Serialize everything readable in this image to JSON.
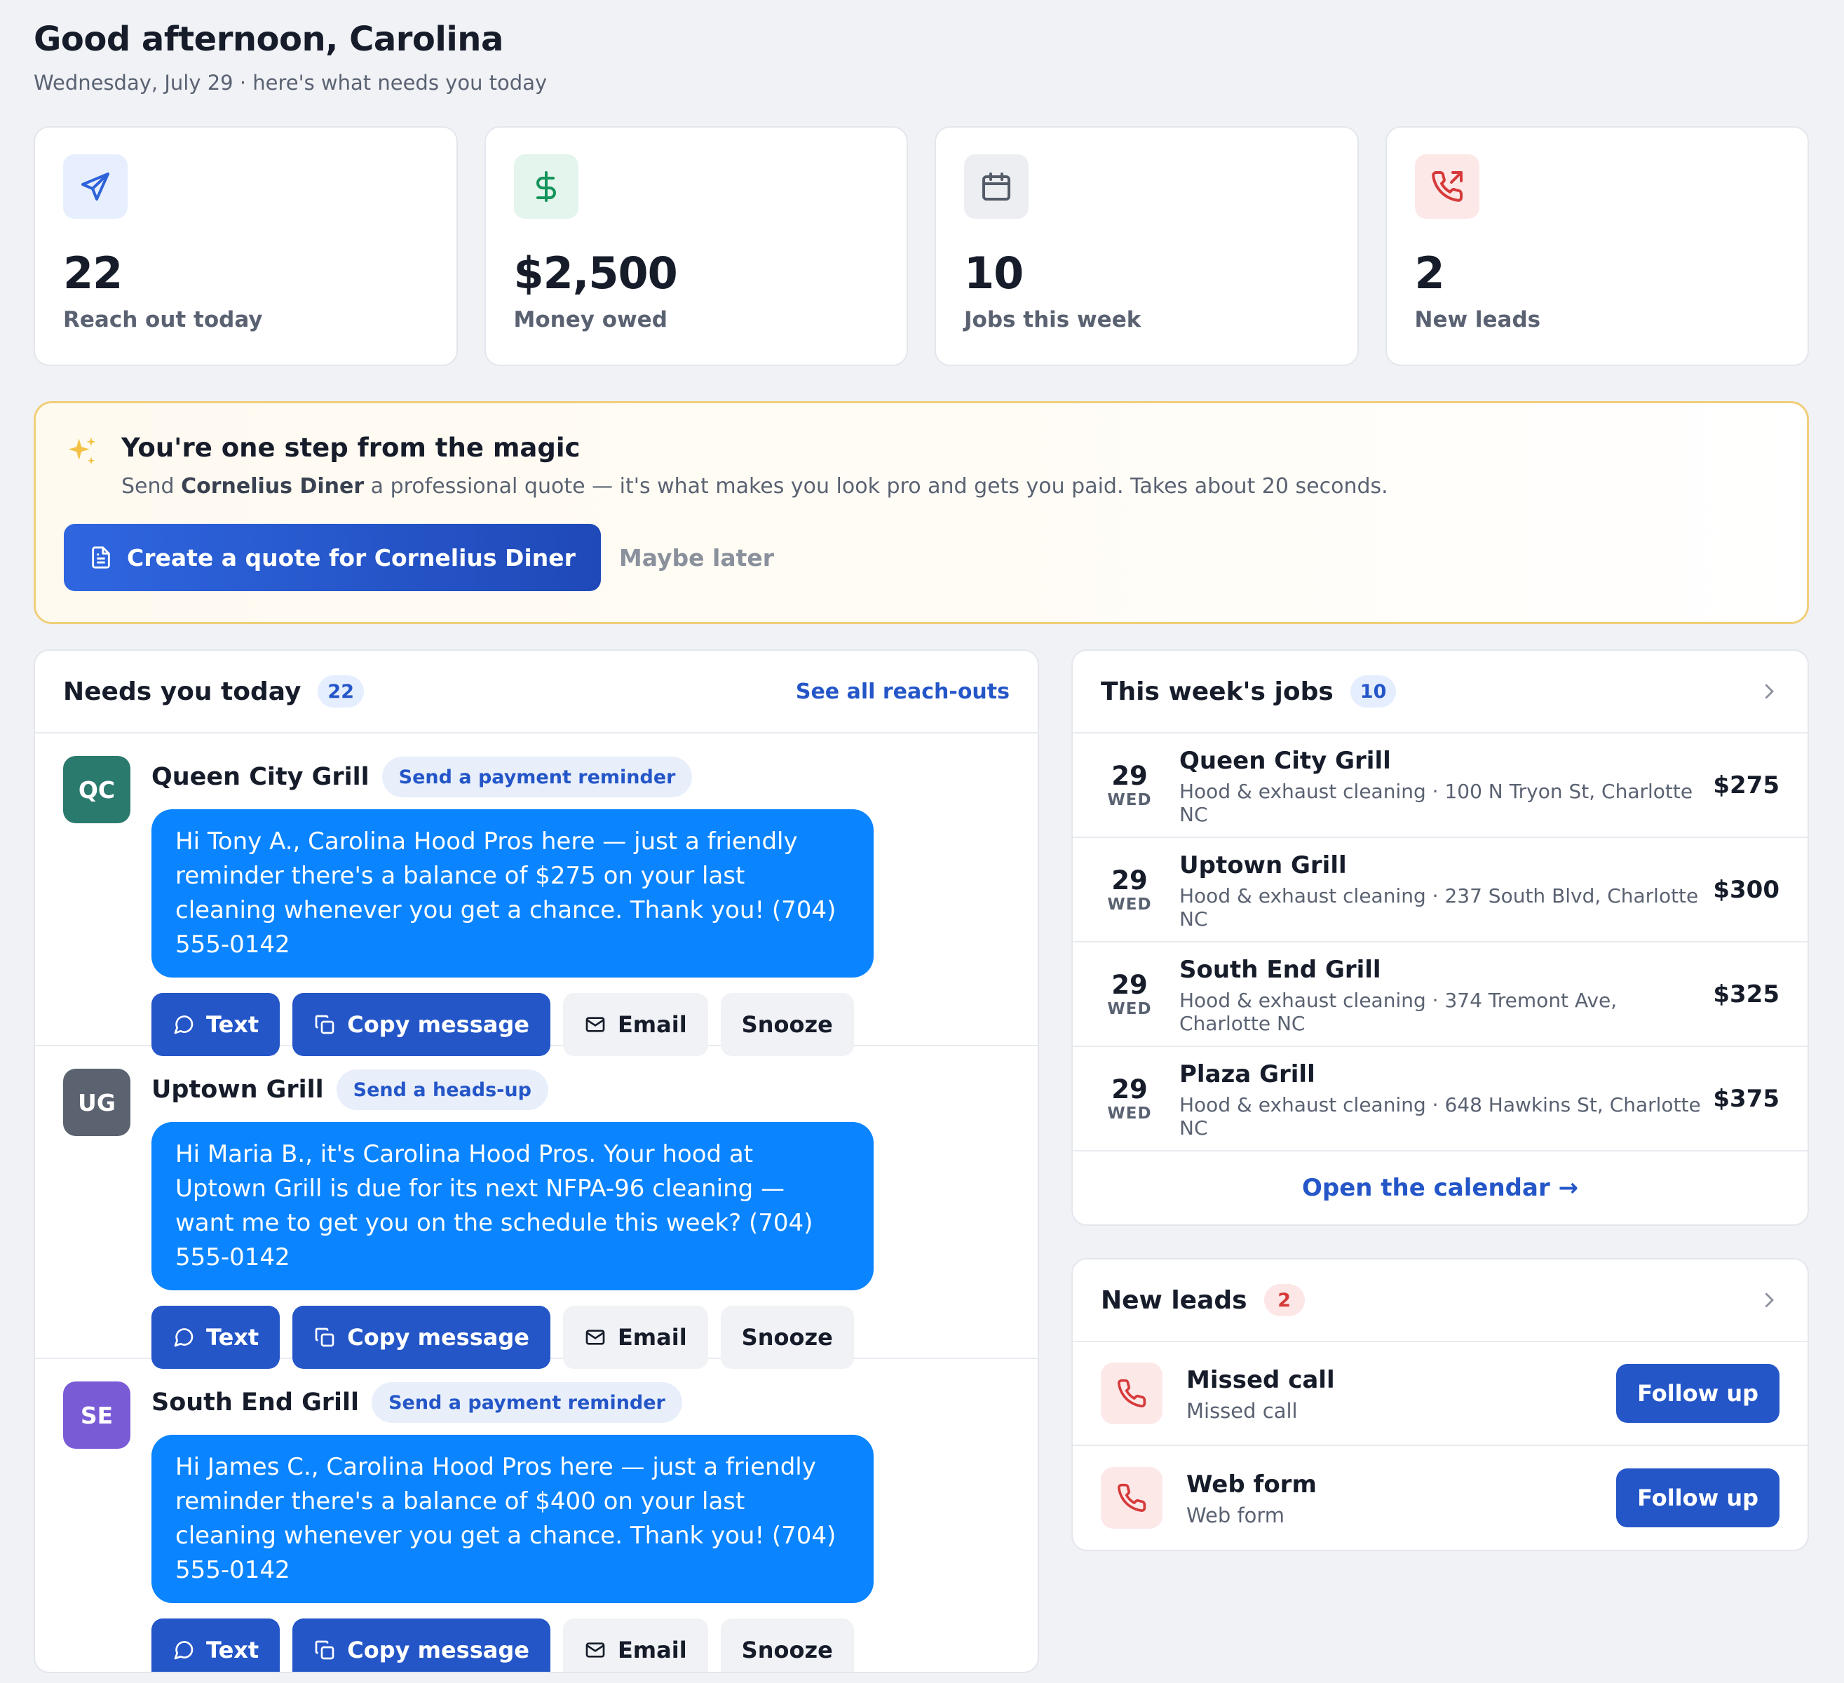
{
  "header": {
    "greeting": "Good afternoon, Carolina",
    "date_line": "Wednesday, July 29 · here's what needs you today"
  },
  "stats": [
    {
      "icon": "send-icon",
      "value": "22",
      "label": "Reach out today",
      "bg": "#e7efff",
      "fg": "#2e62d9"
    },
    {
      "icon": "dollar-icon",
      "value": "$2,500",
      "label": "Money owed",
      "bg": "#e3f5ec",
      "fg": "#14945a"
    },
    {
      "icon": "calendar-icon",
      "value": "10",
      "label": "Jobs this week",
      "bg": "#eceef2",
      "fg": "#545b68"
    },
    {
      "icon": "phone-outgoing-icon",
      "value": "2",
      "label": "New leads",
      "bg": "#fde8e8",
      "fg": "#d63a3a"
    }
  ],
  "banner": {
    "title": "You're one step from the magic",
    "text_before": "Send ",
    "text_bold": "Cornelius Diner",
    "text_after": " a professional quote — it's what makes you look pro and gets you paid. Takes about 20 seconds.",
    "primary_label": "Create a quote for Cornelius Diner",
    "secondary_label": "Maybe later"
  },
  "needs": {
    "title": "Needs you today",
    "count": "22",
    "link": "See all reach-outs",
    "items": [
      {
        "initials": "QC",
        "avatar_color": "#2b7a6e",
        "name": "Queen City Grill",
        "tag": "Send a payment reminder",
        "message": "Hi Tony A., Carolina Hood Pros here — just a friendly reminder there's a balance of $275 on your last cleaning whenever you get a chance. Thank you! (704) 555-0142"
      },
      {
        "initials": "UG",
        "avatar_color": "#5b6270",
        "name": "Uptown Grill",
        "tag": "Send a heads-up",
        "message": "Hi Maria B., it's Carolina Hood Pros. Your hood at Uptown Grill is due for its next NFPA-96 cleaning — want me to get you on the schedule this week? (704) 555-0142"
      },
      {
        "initials": "SE",
        "avatar_color": "#7a5bd6",
        "name": "South End Grill",
        "tag": "Send a payment reminder",
        "message": "Hi James C., Carolina Hood Pros here — just a friendly reminder there's a balance of $400 on your last cleaning whenever you get a chance. Thank you! (704) 555-0142"
      }
    ],
    "actions": {
      "text": "Text",
      "copy": "Copy message",
      "email": "Email",
      "snooze": "Snooze"
    }
  },
  "jobs": {
    "title": "This week's jobs",
    "count": "10",
    "items": [
      {
        "day": "29",
        "dow": "WED",
        "name": "Queen City Grill",
        "desc": "Hood & exhaust cleaning · 100 N Tryon St, Charlotte NC",
        "amount": "$275"
      },
      {
        "day": "29",
        "dow": "WED",
        "name": "Uptown Grill",
        "desc": "Hood & exhaust cleaning · 237 South Blvd, Charlotte NC",
        "amount": "$300"
      },
      {
        "day": "29",
        "dow": "WED",
        "name": "South End Grill",
        "desc": "Hood & exhaust cleaning · 374 Tremont Ave, Charlotte NC",
        "amount": "$325"
      },
      {
        "day": "29",
        "dow": "WED",
        "name": "Plaza Grill",
        "desc": "Hood & exhaust cleaning · 648 Hawkins St, Charlotte NC",
        "amount": "$375"
      }
    ],
    "calendar_link": "Open the calendar →"
  },
  "leads": {
    "title": "New leads",
    "count": "2",
    "items": [
      {
        "title": "Missed call",
        "sub": "Missed call",
        "button": "Follow up"
      },
      {
        "title": "Web form",
        "sub": "Web form",
        "button": "Follow up"
      }
    ]
  }
}
